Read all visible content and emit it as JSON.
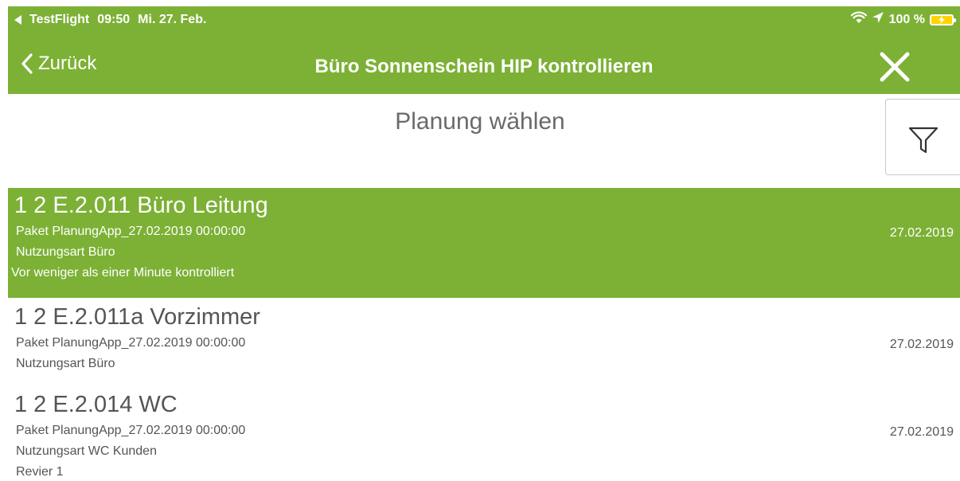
{
  "status_bar": {
    "back_app": "TestFlight",
    "time": "09:50",
    "date": "Mi. 27. Feb.",
    "battery": "100 %",
    "icons": [
      "wifi-icon",
      "location-arrow-icon",
      "battery-charging-icon"
    ]
  },
  "nav": {
    "back_label": "Zurück",
    "title": "Büro Sonnenschein HIP kontrollieren",
    "close_icon": "close-icon"
  },
  "colors": {
    "accent": "#7cb135",
    "text": "#555555",
    "subtitle": "#6a6a6a"
  },
  "page": {
    "subtitle": "Planung wählen",
    "filter_icon": "filter-icon"
  },
  "rooms": [
    {
      "title": "1  2  E.2.011 Büro Leitung",
      "package": "Paket PlanungApp_27.02.2019 00:00:00",
      "usage": "Nutzungsart Büro",
      "extra": "Vor weniger als einer Minute kontrolliert",
      "date": "27.02.2019",
      "selected": true
    },
    {
      "title": "1  2  E.2.011a Vorzimmer",
      "package": "Paket PlanungApp_27.02.2019 00:00:00",
      "usage": "Nutzungsart Büro",
      "date": "27.02.2019",
      "selected": false
    },
    {
      "title": "1  2  E.2.014 WC",
      "package": "Paket PlanungApp_27.02.2019 00:00:00",
      "usage": "Nutzungsart WC Kunden",
      "extra": "Revier 1",
      "date": "27.02.2019",
      "selected": false
    }
  ]
}
